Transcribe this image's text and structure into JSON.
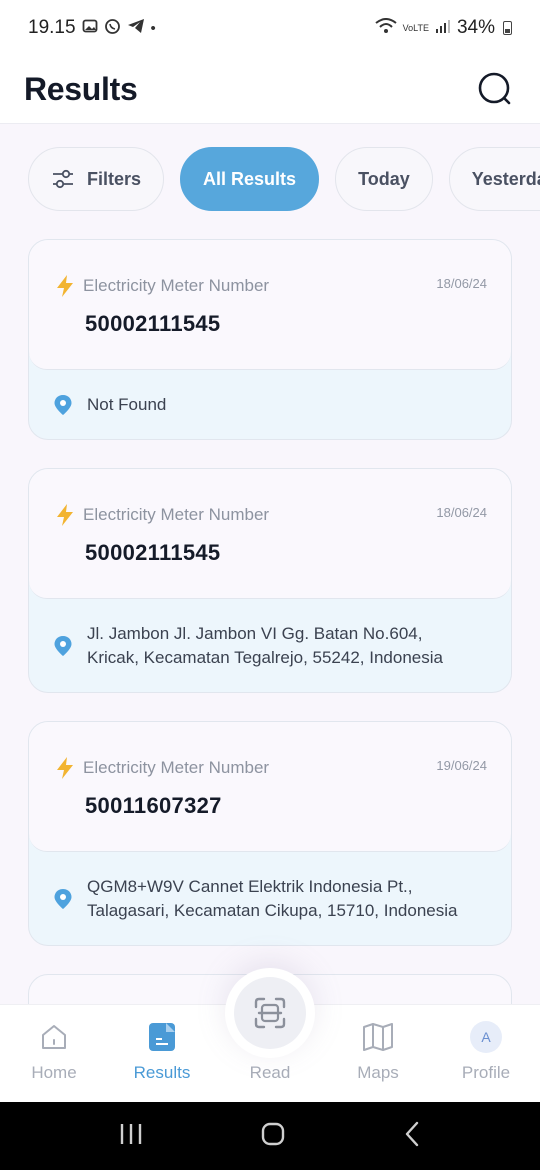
{
  "status_bar": {
    "time": "19.15",
    "battery": "34%",
    "network": "VoLTE"
  },
  "header": {
    "title": "Results",
    "search_icon": "search-icon"
  },
  "filters": {
    "filter_label": "Filters",
    "chips": [
      "All Results",
      "Today",
      "Yesterday"
    ],
    "active_chip": "All Results"
  },
  "results": [
    {
      "label": "Electricity Meter Number",
      "date": "18/06/24",
      "number": "50002111545",
      "address_line1": "Not Found",
      "address_line2": ""
    },
    {
      "label": "Electricity Meter Number",
      "date": "18/06/24",
      "number": "50002111545",
      "address_line1": "Jl. Jambon Jl. Jambon VI Gg. Batan No.604,",
      "address_line2": "Kricak, Kecamatan Tegalrejo, 55242, Indonesia"
    },
    {
      "label": "Electricity Meter Number",
      "date": "19/06/24",
      "number": "50011607327",
      "address_line1": "QGM8+W9V Cannet Elektrik Indonesia Pt.,",
      "address_line2": "Talagasari, Kecamatan Cikupa, 15710, Indonesia"
    }
  ],
  "bottom_nav": {
    "items": [
      {
        "label": "Home",
        "icon": "home-icon"
      },
      {
        "label": "Results",
        "icon": "results-icon"
      },
      {
        "label": "Read",
        "icon": "scan-icon"
      },
      {
        "label": "Maps",
        "icon": "map-icon"
      },
      {
        "label": "Profile",
        "icon": "avatar"
      }
    ],
    "active": "Results",
    "profile_initial": "A"
  },
  "colors": {
    "accent": "#57a7dc",
    "active_nav": "#4a9ad6",
    "bolt": "#f2b431",
    "pin": "#4ea2de"
  }
}
